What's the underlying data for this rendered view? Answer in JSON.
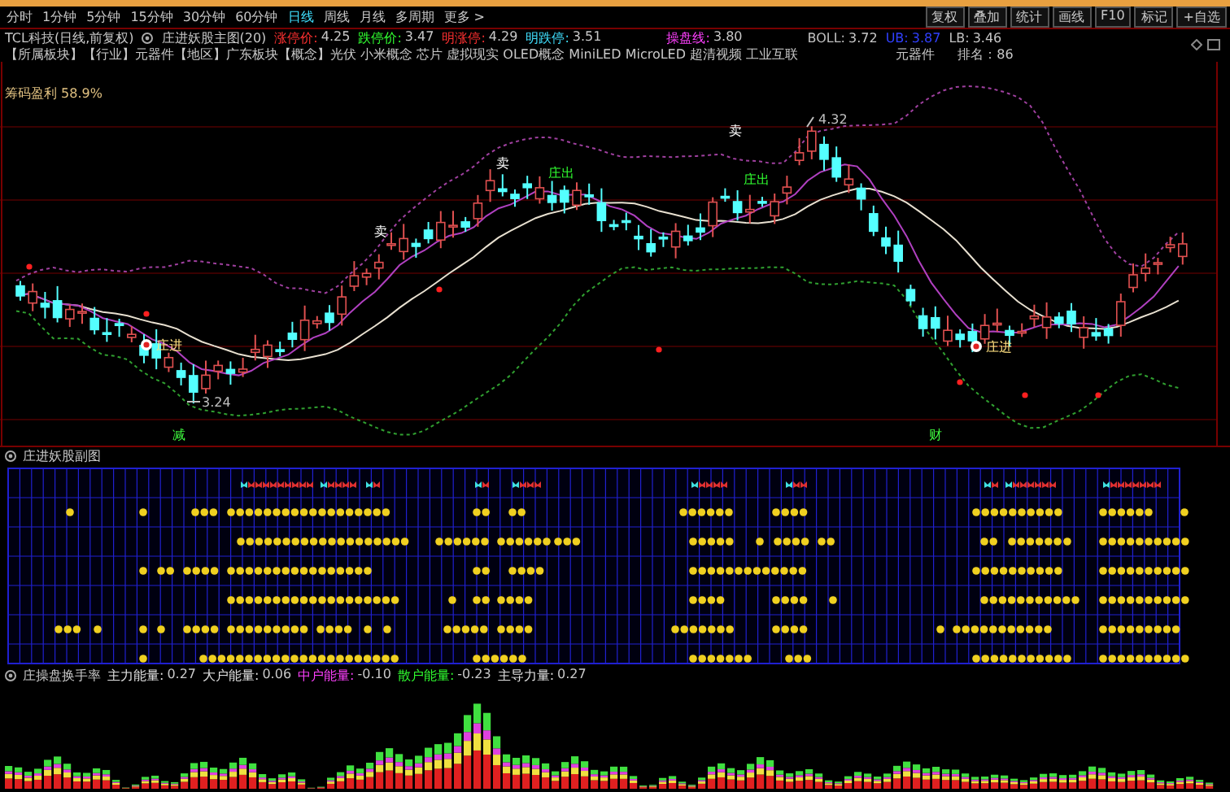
{
  "toolbar": {
    "tabs": [
      {
        "label": "分时",
        "selected": false
      },
      {
        "label": "1分钟",
        "selected": false
      },
      {
        "label": "5分钟",
        "selected": false
      },
      {
        "label": "15分钟",
        "selected": false
      },
      {
        "label": "30分钟",
        "selected": false
      },
      {
        "label": "60分钟",
        "selected": false
      },
      {
        "label": "日线",
        "selected": true
      },
      {
        "label": "周线",
        "selected": false
      },
      {
        "label": "月线",
        "selected": false
      },
      {
        "label": "多周期",
        "selected": false
      },
      {
        "label": "更多 >",
        "selected": false
      }
    ],
    "buttons": [
      "复权",
      "叠加",
      "统计",
      "画线",
      "F10",
      "标记",
      "+自选"
    ]
  },
  "info": {
    "title": "TCL科技(日线,前复权)",
    "indicator": "庄进妖股主图(20)",
    "values": [
      {
        "label": "涨停价:",
        "value": "4.25",
        "color": "#ff3030"
      },
      {
        "label": "跌停价:",
        "value": "3.47",
        "color": "#30ff30"
      },
      {
        "label": "明涨停:",
        "value": "4.29",
        "color": "#ff3030"
      },
      {
        "label": "明跌停:",
        "value": "3.51",
        "color": "#40e0ff"
      },
      {
        "label": "操盘线:",
        "value": "3.80",
        "color": "#ff40ff"
      },
      {
        "label": "BOLL:",
        "value": "3.72",
        "color": "#c0c0c0"
      },
      {
        "label": "UB:",
        "value": "3.87",
        "color": "#3040ff"
      },
      {
        "label": "LB:",
        "value": "3.46",
        "color": "#c0c0c0"
      }
    ]
  },
  "concepts": {
    "text": "【所属板块】【行业】元器件【地区】广东板块【概念】光伏 小米概念 芯片 虚拟现实 OLED概念 MiniLED MicroLED 超清视频 工业互联",
    "industry": "元器件",
    "rank": "排名：86"
  },
  "main_chart": {
    "chip_profit": "筹码盈利 58.9%",
    "markers": [
      {
        "kind": "sell",
        "text": "卖"
      },
      {
        "kind": "sell",
        "text": "卖"
      },
      {
        "kind": "sell",
        "text": "卖"
      },
      {
        "kind": "exit",
        "text": "庄出"
      },
      {
        "kind": "exit",
        "text": "庄出"
      },
      {
        "kind": "enter",
        "text": "庄进"
      },
      {
        "kind": "enter",
        "text": "庄进"
      },
      {
        "kind": "low",
        "text": "3.24"
      },
      {
        "kind": "high",
        "text": "4.32"
      },
      {
        "kind": "tag",
        "text": "减"
      },
      {
        "kind": "tag",
        "text": "财"
      }
    ]
  },
  "sub_chart": {
    "title": "庄进妖股副图"
  },
  "volume_chart": {
    "title": "庄操盘换手率",
    "values": [
      {
        "label": "主力能量:",
        "value": "0.27",
        "color": "#e0e0e0"
      },
      {
        "label": "大户能量:",
        "value": "0.06",
        "color": "#e0e0e0"
      },
      {
        "label": "中户能量:",
        "value": "-0.10",
        "color": "#ff40ff"
      },
      {
        "label": "散户能量:",
        "value": "-0.23",
        "color": "#30ff30"
      },
      {
        "label": "主导力量:",
        "value": "0.27",
        "color": "#e0e0e0"
      }
    ]
  }
}
